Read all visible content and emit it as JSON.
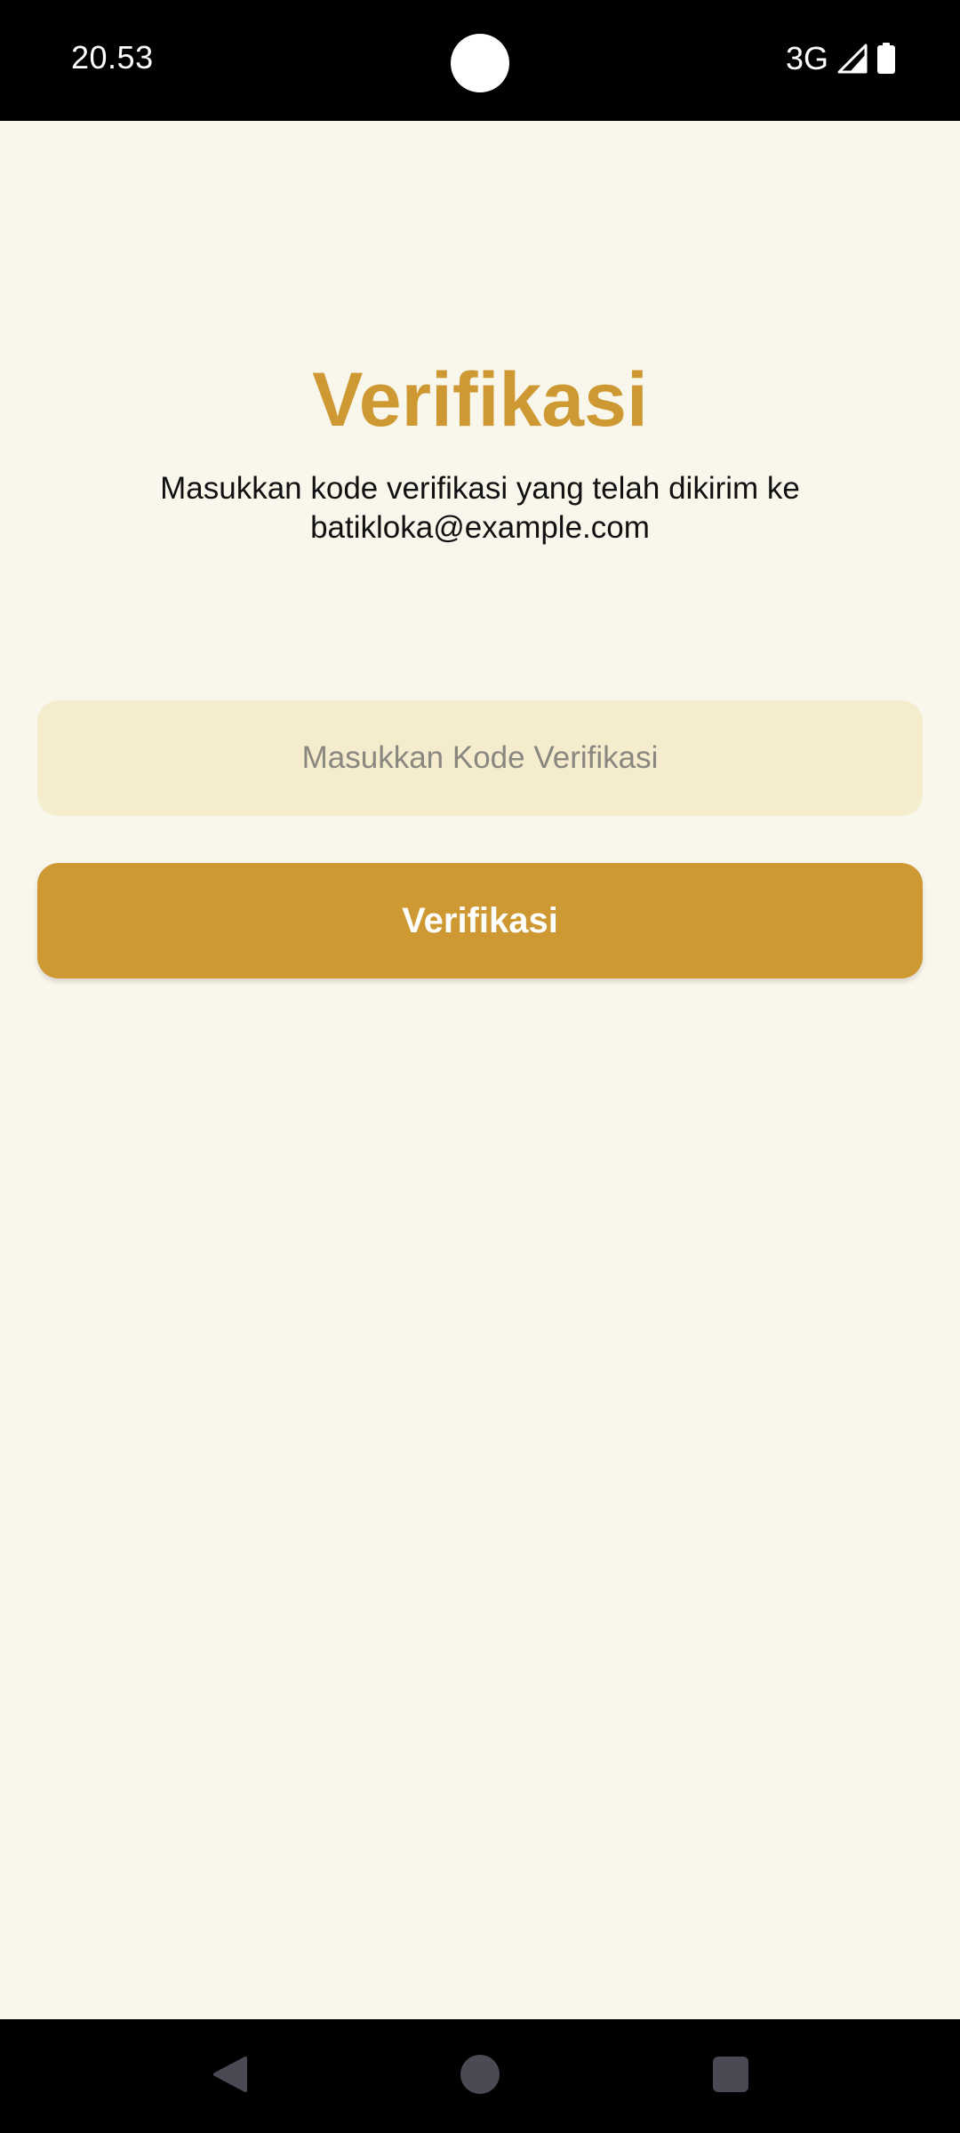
{
  "status_bar": {
    "time": "20.53",
    "network": "3G",
    "icons": [
      "signal-icon",
      "battery-icon"
    ]
  },
  "screen": {
    "title": "Verifikasi",
    "subtitle_line1": "Masukkan kode verifikasi yang telah dikirim ke",
    "subtitle_line2": "batikloka@example.com",
    "code_input": {
      "value": "",
      "placeholder": "Masukkan Kode Verifikasi"
    },
    "verify_button_label": "Verifikasi"
  },
  "nav_bar": {
    "icons": [
      "back-icon",
      "home-icon",
      "recents-icon"
    ]
  },
  "colors": {
    "accent": "#CE9932",
    "background": "#F9F6EC",
    "input_background": "#F5ECCE"
  }
}
